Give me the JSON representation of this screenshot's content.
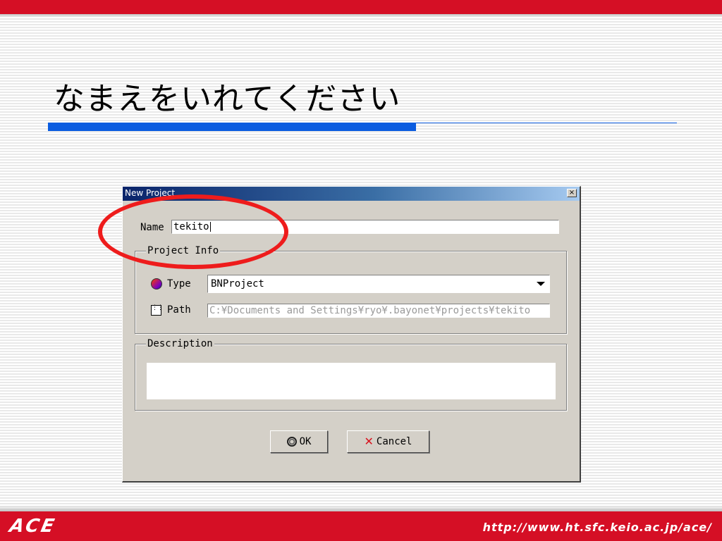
{
  "slide": {
    "title": "なまえをいれてください",
    "footer_logo": "ACE",
    "footer_url": "http://www.ht.sfc.keio.ac.jp/ace/"
  },
  "colors": {
    "brand_red": "#d50f25",
    "title_rule_blue": "#0a5ce0",
    "annotation_red": "#ee1c1c",
    "dialog_face": "#d4d0c8"
  },
  "dialog": {
    "title": "New Project",
    "close_glyph": "×",
    "name_label": "Name",
    "name_value": "tekito",
    "project_info": {
      "legend": "Project Info",
      "type_icon": "project-type-icon",
      "type_label": "Type",
      "type_value": "BNProject",
      "path_icon": "path-icon",
      "path_label": "Path",
      "path_value": "C:¥Documents and Settings¥ryo¥.bayonet¥projects¥tekito"
    },
    "description": {
      "legend": "Description",
      "value": ""
    },
    "buttons": {
      "ok_icon": "ok-icon",
      "ok_label": "OK",
      "cancel_icon": "cancel-x-icon",
      "cancel_label": "Cancel"
    }
  }
}
